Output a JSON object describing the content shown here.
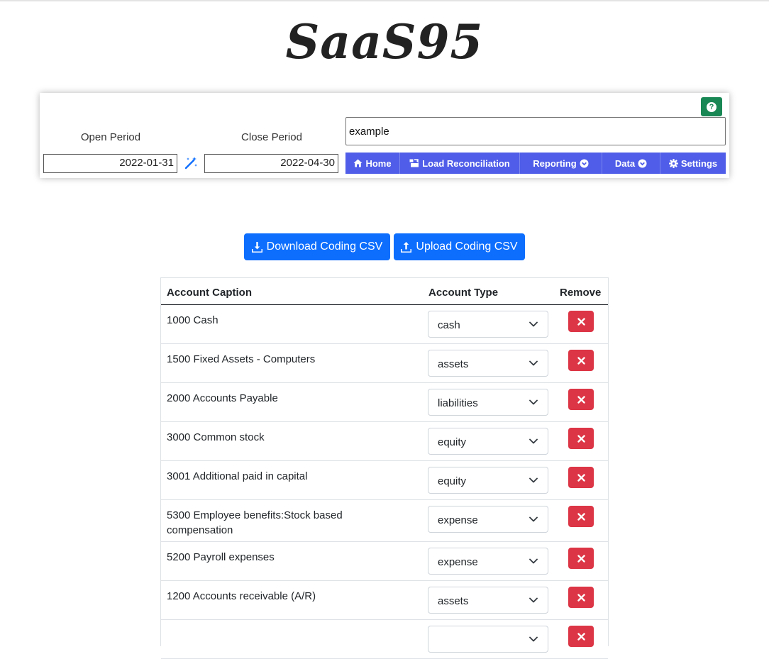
{
  "app": {
    "logo": "SaaS95"
  },
  "toolbar": {
    "help_label": "?",
    "open_period_label": "Open Period",
    "open_period_value": "2022-01-31",
    "close_period_label": "Close Period",
    "close_period_value": "2022-04-30",
    "search_value": "example"
  },
  "nav": [
    {
      "label": "Home",
      "icon": "home-icon"
    },
    {
      "label": "Load Reconciliation",
      "icon": "reconcile-icon"
    },
    {
      "label": "Reporting",
      "icon": "chevron-circle-icon"
    },
    {
      "label": "Data",
      "icon": "chevron-circle-icon"
    },
    {
      "label": "Settings",
      "icon": "gear-icon"
    }
  ],
  "actions": {
    "download_label": "Download Coding CSV",
    "upload_label": "Upload Coding CSV"
  },
  "table": {
    "headers": {
      "caption": "Account Caption",
      "type": "Account Type",
      "remove": "Remove"
    },
    "rows": [
      {
        "caption": "1000 Cash",
        "type": "cash"
      },
      {
        "caption": "1500 Fixed Assets - Computers",
        "type": "assets"
      },
      {
        "caption": "2000 Accounts Payable",
        "type": "liabilities"
      },
      {
        "caption": "3000 Common stock",
        "type": "equity"
      },
      {
        "caption": "3001 Additional paid in capital",
        "type": "equity"
      },
      {
        "caption": "5300 Employee benefits:Stock based compensation",
        "type": "expense"
      },
      {
        "caption": "5200 Payroll expenses",
        "type": "expense"
      },
      {
        "caption": "1200 Accounts receivable (A/R)",
        "type": "assets"
      },
      {
        "caption": "",
        "type": ""
      }
    ]
  },
  "colors": {
    "nav_bg": "#4f5de8",
    "primary": "#0d6efd",
    "danger": "#dc3545",
    "help": "#198754"
  }
}
